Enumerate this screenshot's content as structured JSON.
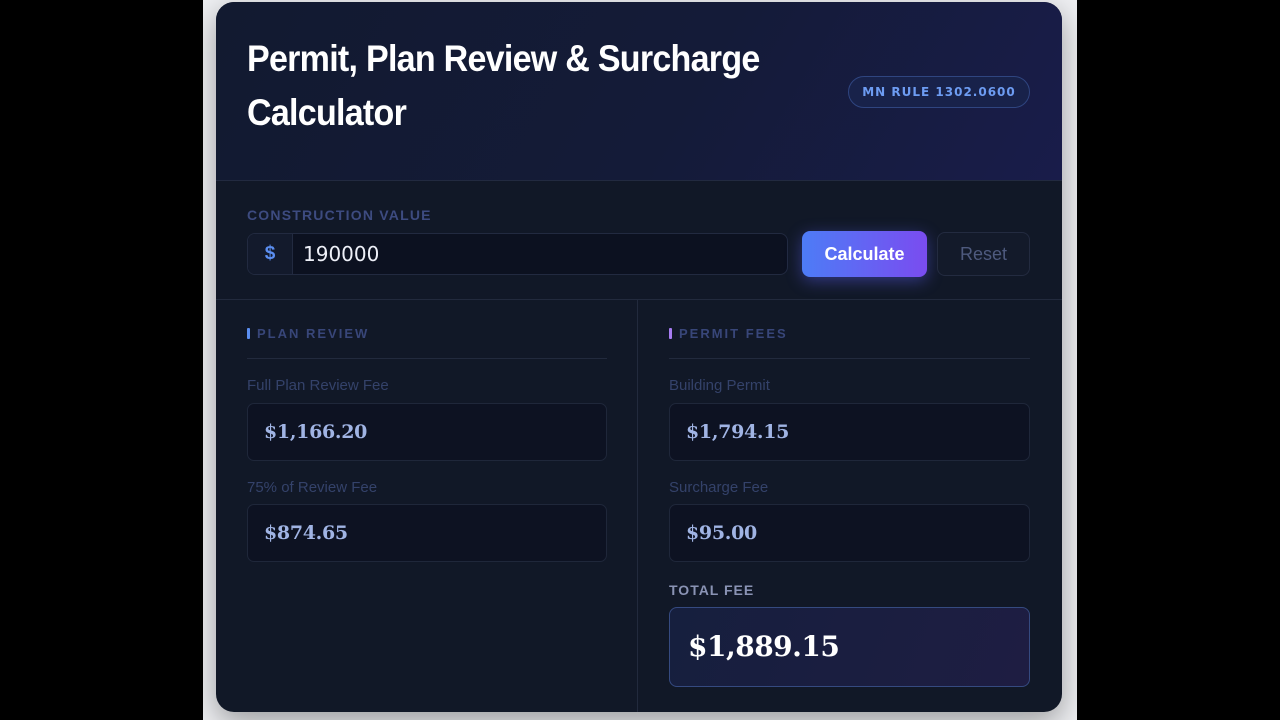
{
  "header": {
    "title": "Permit, Plan Review & Surcharge Calculator",
    "badge": "MN RULE 1302.0600"
  },
  "input": {
    "label": "CONSTRUCTION VALUE",
    "prefix": "$",
    "value": "190000",
    "calculate_label": "Calculate",
    "reset_label": "Reset"
  },
  "plan_review": {
    "heading": "PLAN REVIEW",
    "accent_color": "#5b8ef0",
    "full_fee_label": "Full Plan Review Fee",
    "full_fee_value": "$1,166.20",
    "partial_fee_label": "75% of Review Fee",
    "partial_fee_value": "$874.65"
  },
  "permit_fees": {
    "heading": "PERMIT FEES",
    "accent_color": "#a77cf2",
    "building_permit_label": "Building Permit",
    "building_permit_value": "$1,794.15",
    "surcharge_label": "Surcharge Fee",
    "surcharge_value": "$95.00",
    "total_label": "TOTAL FEE",
    "total_value": "$1,889.15"
  }
}
